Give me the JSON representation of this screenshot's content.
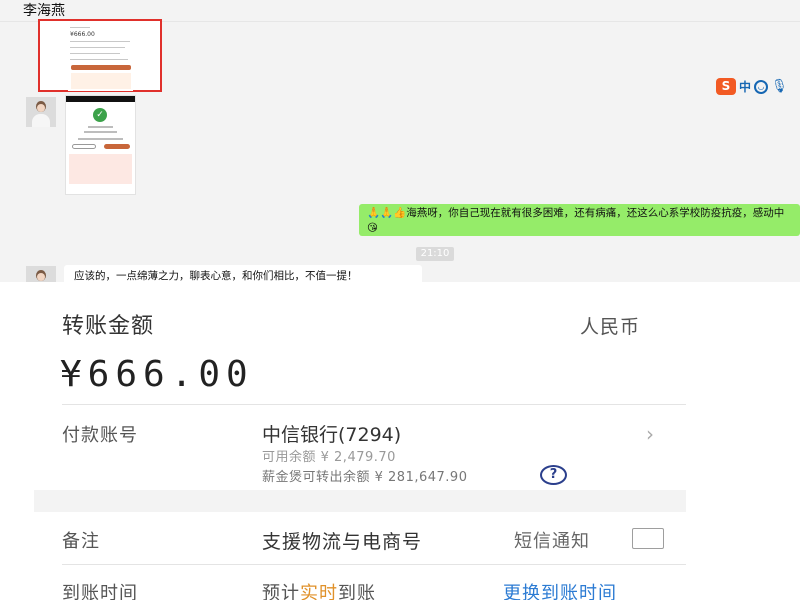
{
  "chat": {
    "contact_name": "李海燕",
    "thumb1_amount": "¥666.00",
    "ime_logo": "S",
    "ime_mode": "中",
    "ime_icons": [
      "smile-icon",
      "mic-icon"
    ],
    "green_message": "🙏🙏👍海燕呀，你自己现在就有很多困难，还有病痛，还这么心系学校防疫抗疫，感动中😘",
    "time": "21:10",
    "white_message": "应该的，一点绵薄之力，聊表心意，和你们相比，不值一提！"
  },
  "transfer": {
    "amount_label": "转账金额",
    "currency_label": "人民币",
    "amount": "¥666.00",
    "account_label": "付款账号",
    "bank": "中信银行(7294)",
    "available": "可用余额 ¥ 2,479.70",
    "salary": "薪金煲可转出余额 ¥ 281,647.90",
    "help_mark": "?",
    "chevron": "›",
    "remark_label": "备注",
    "remark_value": "支援物流与电商号",
    "sms_label": "短信通知",
    "sms_checked": false,
    "arrival_label": "到账时间",
    "arrival_prefix": "预计",
    "arrival_highlight": "实时",
    "arrival_suffix": "到账",
    "change_link": "更换到账时间",
    "highlight_color": "#e0912a",
    "link_color": "#2c7bd3"
  }
}
